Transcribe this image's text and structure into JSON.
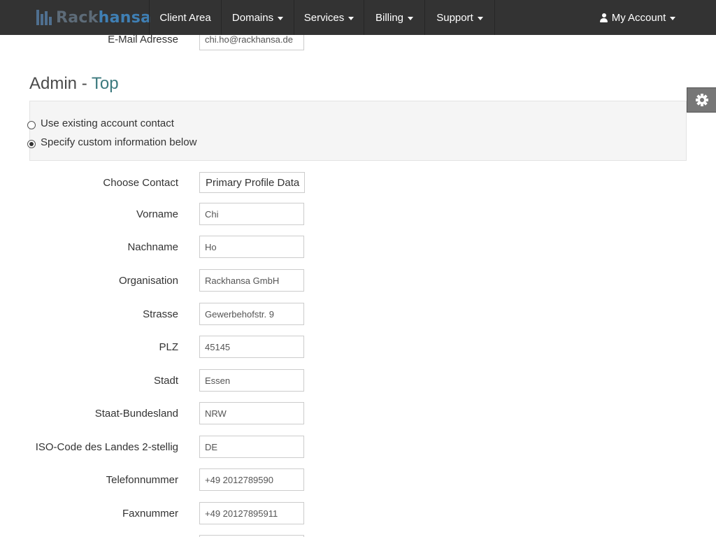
{
  "brand": {
    "part1": "Rack",
    "part2": "hansa"
  },
  "nav": {
    "items": [
      {
        "label": "Client Area",
        "dropdown": false
      },
      {
        "label": "Domains",
        "dropdown": true
      },
      {
        "label": "Services",
        "dropdown": true
      },
      {
        "label": "Billing",
        "dropdown": true
      },
      {
        "label": "Support",
        "dropdown": true
      }
    ],
    "account": {
      "label": "My Account",
      "icon": "user-icon"
    }
  },
  "email_row": {
    "label": "E-Mail Adresse",
    "value": "chi.ho@rackhansa.de"
  },
  "section": {
    "title_prefix": "Admin - ",
    "title_accent": "Top"
  },
  "contact_options": [
    {
      "label": "Use existing account contact",
      "checked": false
    },
    {
      "label": "Specify custom information below",
      "checked": true
    }
  ],
  "fields": [
    {
      "label": "Choose Contact",
      "value": "Primary Profile Data"
    },
    {
      "label": "Vorname",
      "value": "Chi"
    },
    {
      "label": "Nachname",
      "value": "Ho"
    },
    {
      "label": "Organisation",
      "value": "Rackhansa GmbH"
    },
    {
      "label": "Strasse",
      "value": "Gewerbehofstr. 9"
    },
    {
      "label": "PLZ",
      "value": "45145"
    },
    {
      "label": "Stadt",
      "value": "Essen"
    },
    {
      "label": "Staat-Bundesland",
      "value": "NRW"
    },
    {
      "label": "ISO-Code des Landes 2-stellig",
      "value": "DE"
    },
    {
      "label": "Telefonnummer",
      "value": "+49 2012789590"
    },
    {
      "label": "Faxnummer",
      "value": "+49 20127895911"
    }
  ],
  "settings_tab": {
    "icon": "gear-icon"
  },
  "colors": {
    "navbar": "#333333",
    "accent": "#3c7a7e",
    "brand_blue": "#3f7fb4"
  }
}
